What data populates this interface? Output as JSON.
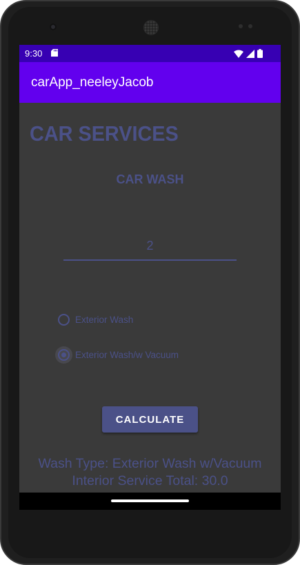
{
  "status_bar": {
    "time": "9:30",
    "icons": [
      "sd-card-icon",
      "wifi-icon",
      "signal-icon",
      "battery-icon"
    ]
  },
  "app_bar": {
    "title": "carApp_neeleyJacob"
  },
  "main": {
    "heading": "CAR SERVICES",
    "subheading": "CAR WASH",
    "quantity_input": {
      "value": "2"
    },
    "wash_options": [
      {
        "label": "Exterior Wash",
        "checked": false
      },
      {
        "label": "Exterior Wash/w Vacuum",
        "checked": true
      }
    ],
    "calculate_label": "CALCULATE",
    "result_line1": "Wash Type: Exterior Wash w/Vacuum",
    "result_line2": "Interior Service Total: 30.0"
  },
  "colors": {
    "status_bar": "#3700b3",
    "app_bar": "#6200ee",
    "accent": "#4b5188",
    "background": "#3a3a3a"
  }
}
